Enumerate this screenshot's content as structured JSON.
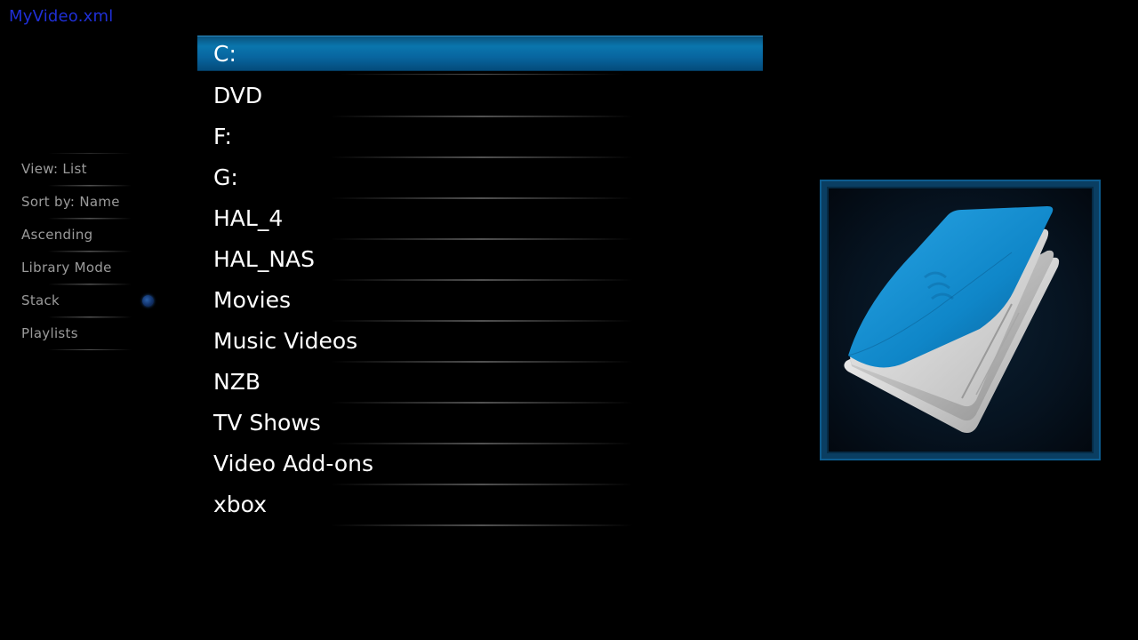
{
  "window": {
    "title": "MyVideo.xml"
  },
  "side_menu": {
    "items": [
      {
        "label": "View: List"
      },
      {
        "label": "Sort by: Name"
      },
      {
        "label": "Ascending"
      },
      {
        "label": "Library Mode"
      },
      {
        "label": "Stack",
        "toggle": true
      },
      {
        "label": "Playlists"
      }
    ]
  },
  "file_list": {
    "selected_index": 0,
    "items": [
      {
        "label": "C:"
      },
      {
        "label": "DVD"
      },
      {
        "label": "F:"
      },
      {
        "label": "G:"
      },
      {
        "label": "HAL_4"
      },
      {
        "label": "HAL_NAS"
      },
      {
        "label": "Movies"
      },
      {
        "label": "Music Videos"
      },
      {
        "label": "NZB"
      },
      {
        "label": "TV Shows"
      },
      {
        "label": "Video Add-ons"
      },
      {
        "label": "xbox"
      }
    ]
  },
  "thumbnail": {
    "icon": "folder-icon"
  },
  "colors": {
    "accent": "#0a76ad",
    "title_text": "#1f2fd6",
    "side_text": "#9b9b9b",
    "list_text": "#ffffff",
    "background": "#000000"
  }
}
